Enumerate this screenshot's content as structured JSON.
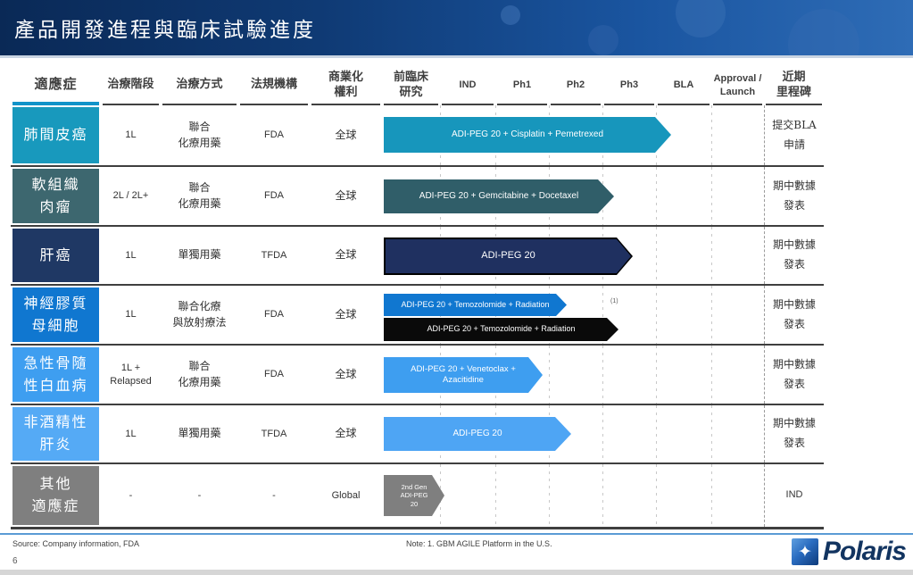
{
  "slide": {
    "title": "產品開發進程與臨床試驗進度",
    "page_number": "6"
  },
  "header": {
    "indication": "適應症",
    "stage": "治療階段",
    "method": "治療方式",
    "agency": "法規機構",
    "rights": "商業化\n權利",
    "preclinical": "前臨床\n研究",
    "phases": [
      "IND",
      "Ph1",
      "Ph2",
      "Ph3",
      "BLA"
    ],
    "approval": "Approval /\nLaunch",
    "milestone": "近期\n里程碑"
  },
  "table": {
    "rows": [
      {
        "indication": "肺間皮癌",
        "indication_color": "#1899BD",
        "stage": "1L",
        "method": "聯合\n化療用藥",
        "agency": "FDA",
        "rights": "全球",
        "arrows": [
          {
            "label": "ADI-PEG 20 + Cisplatin + Pemetrexed",
            "color": "#1796BC"
          }
        ],
        "milestone": "提交BLA\n申請"
      },
      {
        "indication": "軟組織\n肉瘤",
        "indication_color": "#3D676F",
        "stage": "2L / 2L+",
        "method": "聯合\n化療用藥",
        "agency": "FDA",
        "rights": "全球",
        "arrows": [
          {
            "label": "ADI-PEG 20 + Gemcitabine + Docetaxel",
            "color": "#305E69"
          }
        ],
        "milestone": "期中數據\n發表"
      },
      {
        "indication": "肝癌",
        "indication_color": "#1F3864",
        "stage": "1L",
        "method": "單獨用藥",
        "agency": "TFDA",
        "rights": "全球",
        "arrows": [
          {
            "label": "ADI-PEG 20",
            "color": "#1F3060",
            "border": "#000000"
          }
        ],
        "milestone": "期中數據\n發表"
      },
      {
        "indication": "神經膠質\n母細胞",
        "indication_color": "#1077D0",
        "stage": "1L",
        "method": "聯合化療\n與放射療法",
        "agency": "FDA",
        "rights": "全球",
        "arrows": [
          {
            "label": "ADI-PEG 20 + Temozolomide + Radiation",
            "color": "#1077D0"
          },
          {
            "label": "ADI-PEG 20 + Temozolomide + Radiation",
            "color": "#0A0A0A"
          }
        ],
        "note": "(1)",
        "milestone": "期中數據\n發表"
      },
      {
        "indication": "急性骨隨\n性白血病",
        "indication_color": "#3E9EF0",
        "stage": "1L +\nRelapsed",
        "method": "聯合\n化療用藥",
        "agency": "FDA",
        "rights": "全球",
        "arrows": [
          {
            "label": "ADI-PEG 20 + Venetoclax +\nAzacitidine",
            "color": "#3E9EF0"
          }
        ],
        "milestone": "期中數據\n發表"
      },
      {
        "indication": "非酒精性\n肝炎",
        "indication_color": "#55AAF5",
        "stage": "1L",
        "method": "單獨用藥",
        "agency": "TFDA",
        "rights": "全球",
        "arrows": [
          {
            "label": "ADI-PEG 20",
            "color": "#4EA5F4"
          }
        ],
        "milestone": "期中數據\n發表"
      },
      {
        "indication": "其他\n適應症",
        "indication_color": "#7F7F7F",
        "stage": "-",
        "method": "-",
        "agency": "-",
        "rights": "Global",
        "arrows": [
          {
            "label": "2nd Gen\nADI-PEG\n20",
            "color": "#7F7F7F"
          }
        ],
        "milestone": "IND"
      }
    ]
  },
  "footer": {
    "source": "Source: Company information, FDA",
    "note": "Note: 1. GBM AGILE Platform in the U.S."
  },
  "logo": {
    "star": "✦",
    "text": "Polaris"
  },
  "colors": {
    "title_gradient_start": "#0A2956",
    "title_gradient_end": "#2E6CB6",
    "header_accent_underline": "#1193C9",
    "row_separator": "#3F3F3F",
    "footer_line": "#5B9BD5",
    "logo_navy": "#123460"
  }
}
